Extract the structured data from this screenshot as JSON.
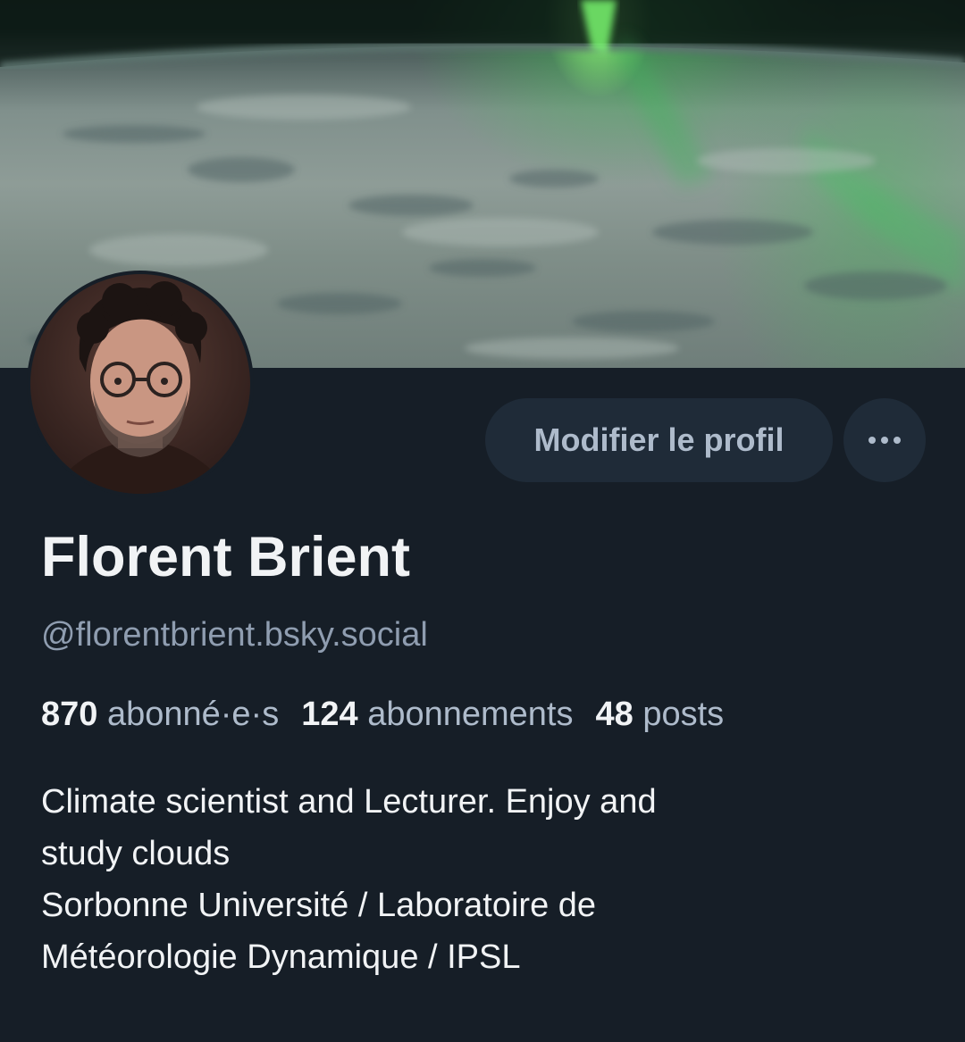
{
  "profile": {
    "display_name": "Florent Brient",
    "handle": "@florentbrient.bsky.social",
    "edit_button_label": "Modifier le profil",
    "more_button_icon": "ellipsis-icon",
    "stats": [
      {
        "number": "870",
        "label": "abonné·e·s"
      },
      {
        "number": "124",
        "label": "abonnements"
      },
      {
        "number": "48",
        "label": "posts"
      }
    ],
    "bio_lines": [
      "Climate scientist and Lecturer. Enjoy and",
      "study clouds",
      "Sorbonne Université / Laboratoire de",
      "Météorologie Dynamique / IPSL"
    ]
  },
  "colors": {
    "background": "#161e27",
    "button_background": "#1f2b38",
    "secondary_text": "#8f9db0",
    "primary_text": "#f1f3f5"
  }
}
